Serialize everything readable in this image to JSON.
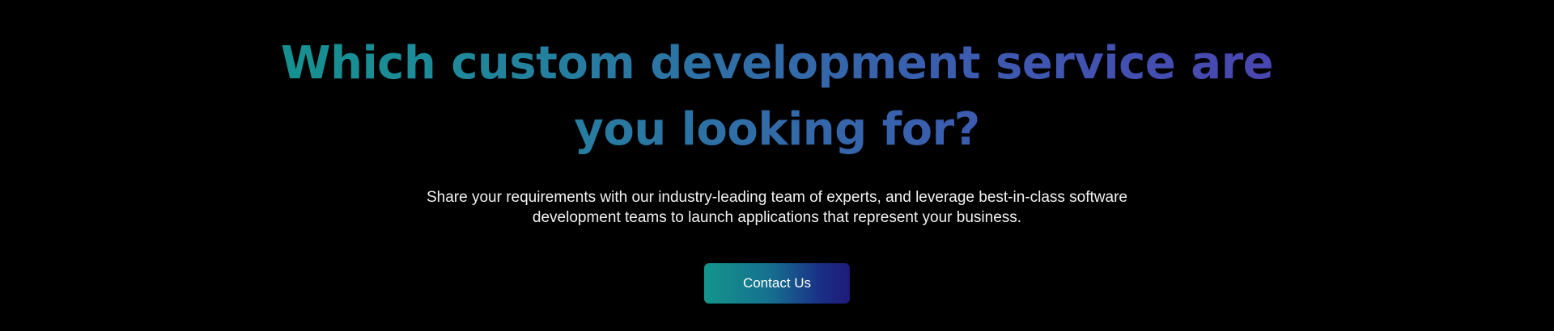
{
  "cta": {
    "headline": "Which custom development service are you looking for?",
    "description": "Share your requirements with our industry-leading team of experts, and leverage best-in-class software development teams to launch applications that represent your business.",
    "button_label": "Contact Us"
  },
  "colors": {
    "background": "#000000",
    "headline_gradient_start": "#13928d",
    "headline_gradient_end": "#4a44b0",
    "button_gradient_start": "#13958b",
    "button_gradient_end": "#1f1a7a",
    "body_text": "#f2f2f2"
  }
}
